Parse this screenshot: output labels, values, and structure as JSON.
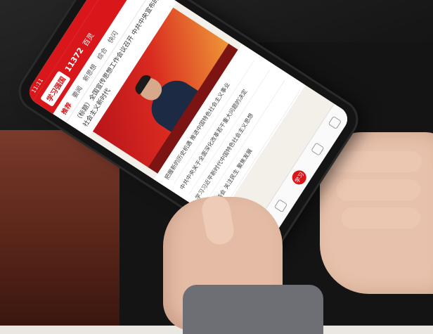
{
  "phone": {
    "status_time": "11:11",
    "app": {
      "logo": "学习强国",
      "score": "11372",
      "nav_label": "百灵",
      "search_icon": "search-icon",
      "menu_icon": "menu-icon"
    },
    "tabs": [
      "推荐",
      "要闻",
      "新思想",
      "综合",
      "快闪"
    ],
    "headline": "（标题）全国宣传思想工作会议召开 中共中央宣布的社会主义新时代",
    "list_items": [
      "把握新的历史机遇 推进中国特色社会主义事业",
      "中共中央关于全面深化改革若干重大问题的决定",
      "学习习近平新时代中国特色社会主义思想",
      "全国两会 关注民生 聚焦发展"
    ],
    "bottom_button": "学习"
  }
}
